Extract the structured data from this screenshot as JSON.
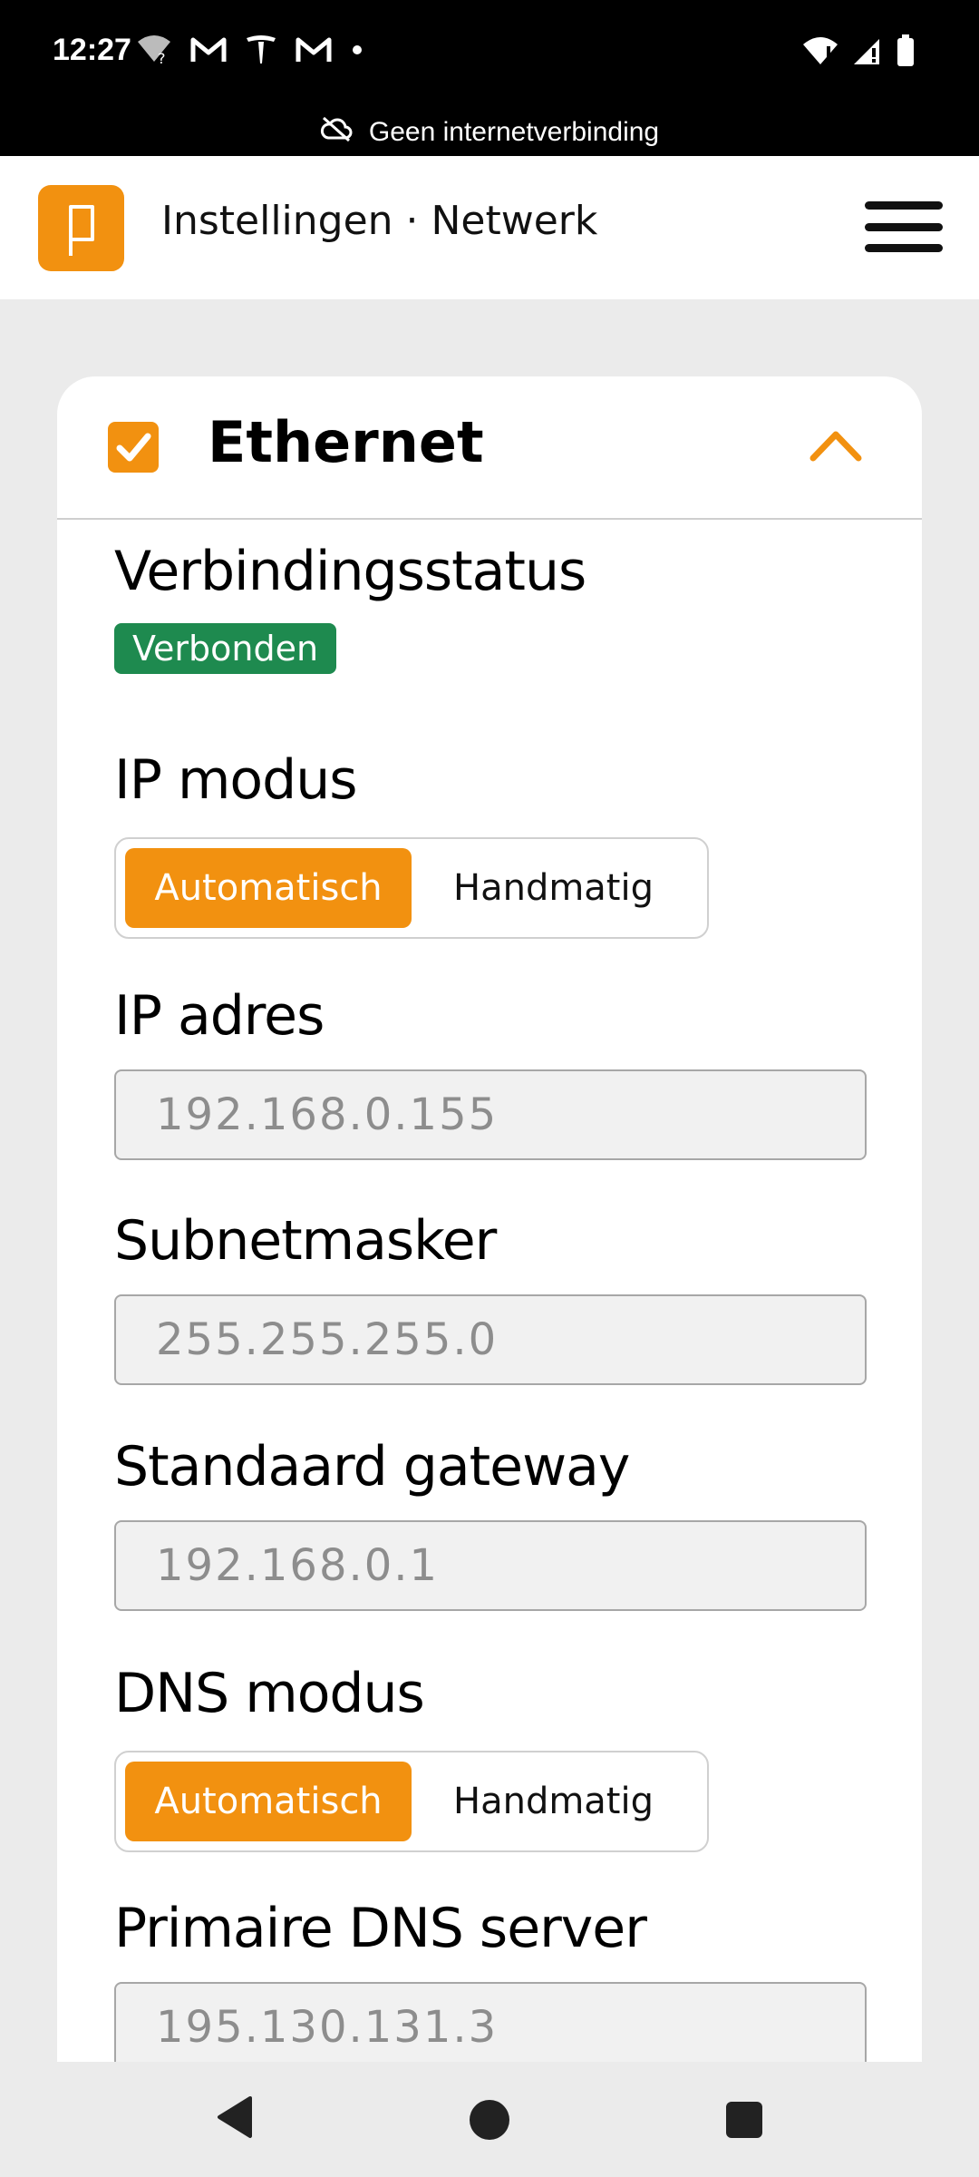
{
  "status_bar": {
    "time": "12:27",
    "left_icons": [
      "wifi-question-icon",
      "gmail-icon",
      "tesla-icon",
      "gmail-icon",
      "dot-icon"
    ],
    "right_icons": [
      "wifi-alert-icon",
      "signal-alert-icon",
      "battery-icon"
    ]
  },
  "connectivity_notice": {
    "icon": "cloud-off-icon",
    "text": "Geen internetverbinding"
  },
  "header": {
    "logo_icon": "brand-logo-icon",
    "title": "Instellingen · Netwerk",
    "menu_icon": "hamburger-menu-icon"
  },
  "card": {
    "checked": true,
    "title": "Ethernet",
    "collapse_icon": "chevron-up-icon",
    "accent_color": "#f29110",
    "connection_status": {
      "label": "Verbindingsstatus",
      "value": "Verbonden",
      "badge_color": "#1e8a4f"
    },
    "ip_mode": {
      "label": "IP modus",
      "options": [
        "Automatisch",
        "Handmatig"
      ],
      "selected": "Automatisch"
    },
    "ip_address": {
      "label": "IP adres",
      "value": "192.168.0.155"
    },
    "subnet_mask": {
      "label": "Subnetmasker",
      "value": "255.255.255.0"
    },
    "default_gateway": {
      "label": "Standaard gateway",
      "value": "192.168.0.1"
    },
    "dns_mode": {
      "label": "DNS modus",
      "options": [
        "Automatisch",
        "Handmatig"
      ],
      "selected": "Automatisch"
    },
    "primary_dns": {
      "label": "Primaire DNS server",
      "value": "195.130.131.3"
    }
  },
  "nav_bar": {
    "back_icon": "back-triangle-icon",
    "home_icon": "home-circle-icon",
    "recents_icon": "recents-square-icon"
  }
}
